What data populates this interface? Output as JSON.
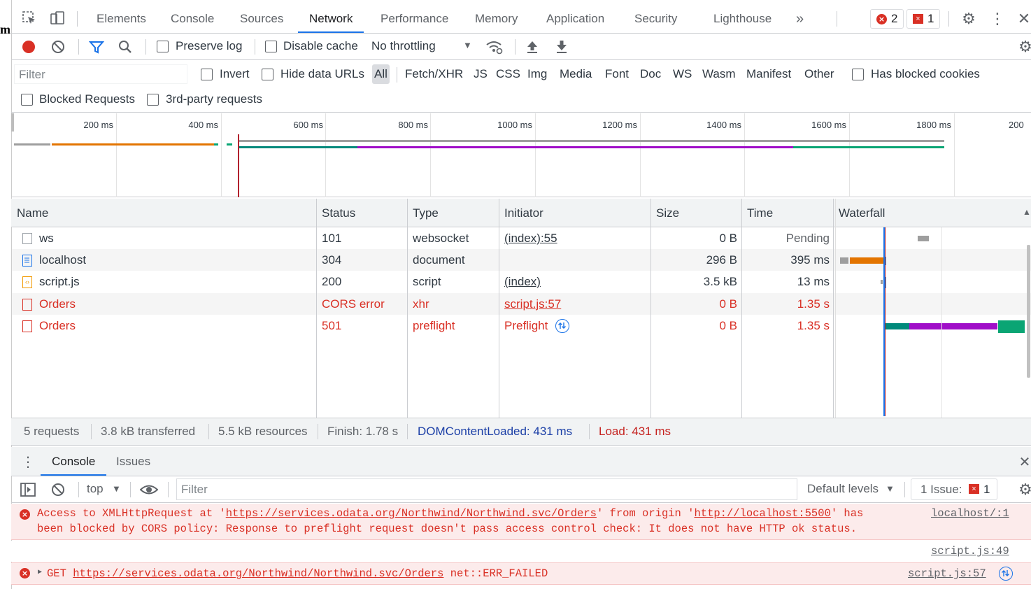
{
  "stray_char": "m",
  "tabs": [
    "Elements",
    "Console",
    "Sources",
    "Network",
    "Performance",
    "Memory",
    "Application",
    "Security",
    "Lighthouse"
  ],
  "active_tab": "Network",
  "badges": {
    "errors": "2",
    "issues": "1"
  },
  "toolbar": {
    "preserve_log": "Preserve log",
    "disable_cache": "Disable cache",
    "throttling": "No throttling"
  },
  "filter": {
    "placeholder": "Filter",
    "invert": "Invert",
    "hide_data_urls": "Hide data URLs",
    "types": [
      "All",
      "Fetch/XHR",
      "JS",
      "CSS",
      "Img",
      "Media",
      "Font",
      "Doc",
      "WS",
      "Wasm",
      "Manifest",
      "Other"
    ],
    "selected_type": "All",
    "has_blocked_cookies": "Has blocked cookies",
    "blocked_requests": "Blocked Requests",
    "third_party": "3rd-party requests"
  },
  "overview_ticks": [
    "200 ms",
    "400 ms",
    "600 ms",
    "800 ms",
    "1000 ms",
    "1200 ms",
    "1400 ms",
    "1600 ms",
    "1800 ms",
    "200"
  ],
  "columns": [
    "Name",
    "Status",
    "Type",
    "Initiator",
    "Size",
    "Time",
    "Waterfall"
  ],
  "rows": [
    {
      "name": "ws",
      "status": "101",
      "type": "websocket",
      "initiator": "(index):55",
      "size": "0 B",
      "time": "Pending",
      "error": false
    },
    {
      "name": "localhost",
      "status": "304",
      "type": "document",
      "initiator": "",
      "size": "296 B",
      "time": "395 ms",
      "error": false
    },
    {
      "name": "script.js",
      "status": "200",
      "type": "script",
      "initiator": "(index)",
      "size": "3.5 kB",
      "time": "13 ms",
      "error": false
    },
    {
      "name": "Orders",
      "status": "CORS error",
      "type": "xhr",
      "initiator": "script.js:57",
      "size": "0 B",
      "time": "1.35 s",
      "error": true
    },
    {
      "name": "Orders",
      "status": "501",
      "type": "preflight",
      "initiator": "Preflight",
      "size": "0 B",
      "time": "1.35 s",
      "error": true
    }
  ],
  "summary": {
    "requests": "5 requests",
    "transferred": "3.8 kB transferred",
    "resources": "5.5 kB resources",
    "finish": "Finish: 1.78 s",
    "dom": "DOMContentLoaded: 431 ms",
    "load": "Load: 431 ms"
  },
  "drawer": {
    "tabs": [
      "Console",
      "Issues"
    ],
    "context": "top",
    "filter_placeholder": "Filter",
    "levels": "Default levels",
    "issues_label": "1 Issue:",
    "issues_count": "1"
  },
  "messages": {
    "m1_pre": "Access to XMLHttpRequest at '",
    "m1_url": "https://services.odata.org/Northwind/Northwind.svc/Orders",
    "m1_mid": "' from origin '",
    "m1_origin": "http://localhost:5500",
    "m1_post": "' has",
    "m1_line2": "been blocked by CORS policy: Response to preflight request doesn't pass access control check: It does not have HTTP ok status.",
    "m1_source": "localhost/:1",
    "m2_source": "script.js:49",
    "m3_method": "GET",
    "m3_url": "https://services.odata.org/Northwind/Northwind.svc/Orders",
    "m3_err": "net::ERR_FAILED",
    "m3_source": "script.js:57"
  },
  "colors": {
    "accent": "#1a73e8",
    "error": "#d93025",
    "record": "#d93025"
  }
}
